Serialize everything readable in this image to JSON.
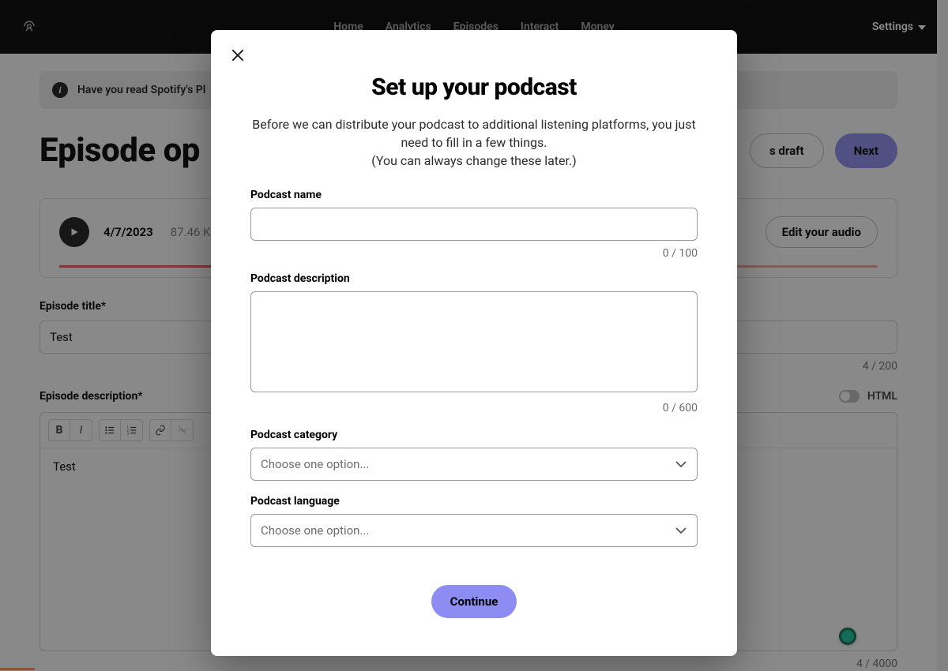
{
  "nav": {
    "links": [
      "Home",
      "Analytics",
      "Episodes",
      "Interact",
      "Money"
    ],
    "settings": "Settings"
  },
  "banner": {
    "text": "Have you read Spotify's Pl"
  },
  "page_title": "Episode op",
  "buttons": {
    "save_draft": "s draft",
    "next": "Next",
    "edit_audio": "Edit your audio",
    "continue": "Continue"
  },
  "audio": {
    "date": "4/7/2023",
    "size": "87.46 K"
  },
  "form": {
    "episode_title_label": "Episode title*",
    "episode_title_value": "Test",
    "episode_title_counter": "4  /  200",
    "episode_desc_label": "Episode description*",
    "html_label": "HTML",
    "editor_text": "Test",
    "editor_counter": "4  /  4000"
  },
  "modal": {
    "title": "Set up your podcast",
    "subtitle": "Before we can distribute your podcast to additional listening platforms, you just need to fill in a few things.",
    "subtitle2": "(You can always change these later.)",
    "name_label": "Podcast name",
    "name_counter": "0   /   100",
    "desc_label": "Podcast description",
    "desc_counter": "0   /   600",
    "category_label": "Podcast category",
    "language_label": "Podcast language",
    "select_placeholder": "Choose one option..."
  }
}
